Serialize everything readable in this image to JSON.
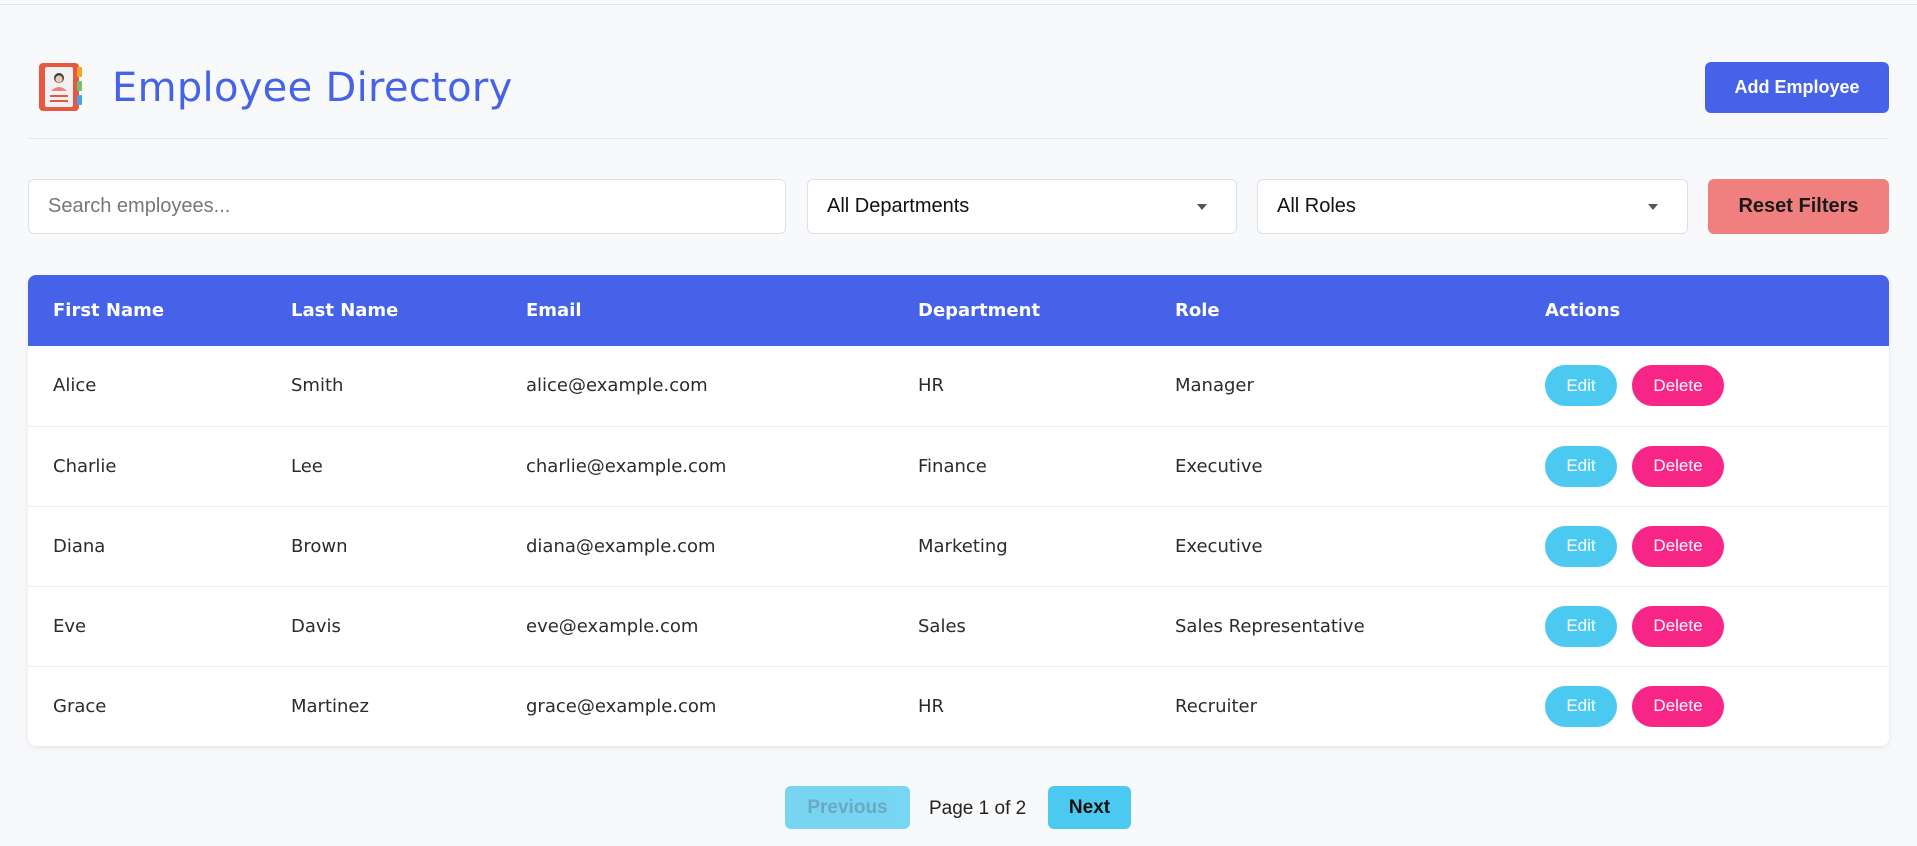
{
  "header": {
    "title": "Employee Directory",
    "logo_icon": "address-book-icon",
    "add_button_label": "Add Employee"
  },
  "filters": {
    "search_placeholder": "Search employees...",
    "search_value": "",
    "department_selected": "All Departments",
    "role_selected": "All Roles",
    "reset_label": "Reset Filters"
  },
  "table": {
    "columns": [
      "First Name",
      "Last Name",
      "Email",
      "Department",
      "Role",
      "Actions"
    ],
    "rows": [
      {
        "first": "Alice",
        "last": "Smith",
        "email": "alice@example.com",
        "department": "HR",
        "role": "Manager"
      },
      {
        "first": "Charlie",
        "last": "Lee",
        "email": "charlie@example.com",
        "department": "Finance",
        "role": "Executive"
      },
      {
        "first": "Diana",
        "last": "Brown",
        "email": "diana@example.com",
        "department": "Marketing",
        "role": "Executive"
      },
      {
        "first": "Eve",
        "last": "Davis",
        "email": "eve@example.com",
        "department": "Sales",
        "role": "Sales Representative"
      },
      {
        "first": "Grace",
        "last": "Martinez",
        "email": "grace@example.com",
        "department": "HR",
        "role": "Recruiter"
      }
    ],
    "edit_label": "Edit",
    "delete_label": "Delete"
  },
  "pagination": {
    "previous_label": "Previous",
    "page_info": "Page 1 of 2",
    "next_label": "Next"
  },
  "colors": {
    "primary": "#4562e8",
    "edit": "#4cc9f0",
    "delete": "#f72585",
    "reset": "#f08080"
  }
}
